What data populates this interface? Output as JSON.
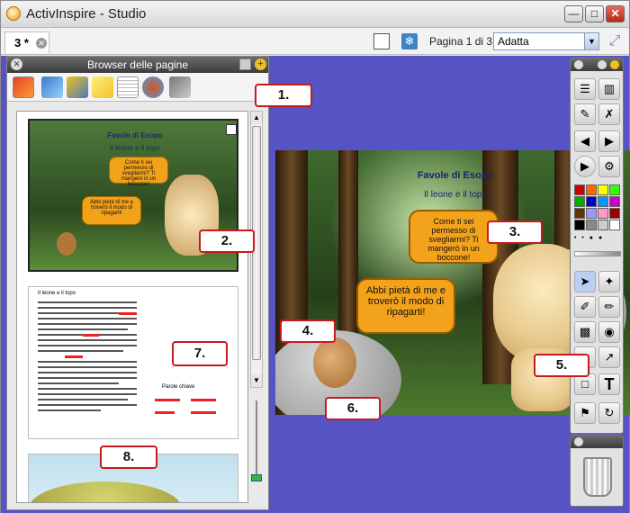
{
  "window": {
    "title": "ActivInspire - Studio"
  },
  "tabs": [
    {
      "label": "3 *"
    }
  ],
  "pagebar": {
    "page_label": "Pagina 1 di 3",
    "zoom_value": "Adatta"
  },
  "browser": {
    "title": "Browser delle pagine"
  },
  "slide": {
    "title": "Favole di Esopo",
    "subtitle": "Il leone e il topo",
    "bubble_lion": "Come ti sei permesso di svegliarmi? Ti mangerò in un boccone!",
    "bubble_mouse": "Abbi pietà di me e troverò il modo di ripagarti!"
  },
  "thumb2": {
    "heading": "Il leone e il topo",
    "keywords_label": "Parole chiave"
  },
  "callouts": [
    "1.",
    "2.",
    "3.",
    "4.",
    "5.",
    "6.",
    "7.",
    "8."
  ],
  "palette": [
    "#cc0000",
    "#ff6600",
    "#ffff00",
    "#33ff00",
    "#00aa00",
    "#0000cc",
    "#0099ff",
    "#cc00cc",
    "#663300",
    "#9999ff",
    "#ff99cc",
    "#990000",
    "#000000",
    "#888888",
    "#cccccc",
    "#ffffff"
  ]
}
